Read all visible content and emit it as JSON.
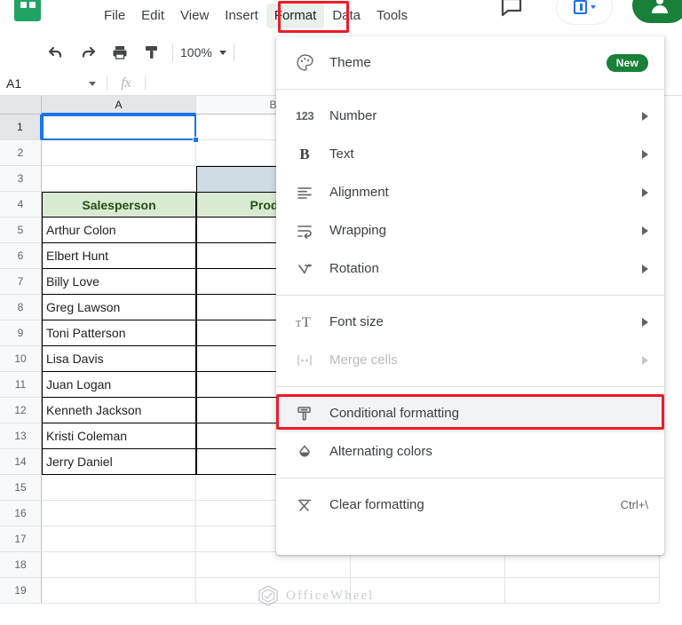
{
  "app": {
    "logo": "sheets-logo",
    "zoom": "100%"
  },
  "menubar": {
    "items": [
      {
        "label": "File",
        "active": false
      },
      {
        "label": "Edit",
        "active": false
      },
      {
        "label": "View",
        "active": false
      },
      {
        "label": "Insert",
        "active": false
      },
      {
        "label": "Format",
        "active": true
      },
      {
        "label": "Data",
        "active": false
      },
      {
        "label": "Tools",
        "active": false
      }
    ]
  },
  "toolbar": {
    "undo": "undo-icon",
    "redo": "redo-icon",
    "print": "print-icon",
    "paint": "paint-format-icon",
    "zoom_value": "100%"
  },
  "formula_bar": {
    "name_box": "A1",
    "fx_label": "fx",
    "formula_value": "",
    "placeholder": ""
  },
  "grid": {
    "columns": [
      "A",
      "B"
    ],
    "rows": [
      "1",
      "2",
      "3",
      "4",
      "5",
      "6",
      "7",
      "8",
      "9",
      "10",
      "11",
      "12",
      "13",
      "14",
      "15",
      "16",
      "17",
      "18",
      "19"
    ],
    "selected_cell": "A1",
    "header_row": {
      "a": "Salesperson",
      "b": "Product"
    },
    "salespersons": [
      "Arthur Colon",
      "Elbert Hunt",
      "Billy Love",
      "Greg Lawson",
      "Toni Patterson",
      "Lisa Davis",
      "Juan Logan",
      "Kenneth Jackson",
      "Kristi Coleman",
      "Jerry Daniel"
    ],
    "colors": {
      "header_fill": "#d9ead3",
      "header_text": "#274e13",
      "b3_fill": "#cfdce3",
      "selection": "#1a73e8"
    }
  },
  "format_menu": {
    "sections": [
      {
        "items": [
          {
            "label": "Theme",
            "icon": "palette-icon",
            "badge": "New",
            "arrow": false,
            "shortcut": "",
            "disabled": false,
            "highlighted": false
          }
        ]
      },
      {
        "items": [
          {
            "label": "Number",
            "icon": "number-123-icon",
            "badge": "",
            "arrow": true,
            "shortcut": "",
            "disabled": false,
            "highlighted": false
          },
          {
            "label": "Text",
            "icon": "bold-b-icon",
            "badge": "",
            "arrow": true,
            "shortcut": "",
            "disabled": false,
            "highlighted": false
          },
          {
            "label": "Alignment",
            "icon": "align-left-icon",
            "badge": "",
            "arrow": true,
            "shortcut": "",
            "disabled": false,
            "highlighted": false
          },
          {
            "label": "Wrapping",
            "icon": "wrap-text-icon",
            "badge": "",
            "arrow": true,
            "shortcut": "",
            "disabled": false,
            "highlighted": false
          },
          {
            "label": "Rotation",
            "icon": "rotation-icon",
            "badge": "",
            "arrow": true,
            "shortcut": "",
            "disabled": false,
            "highlighted": false
          }
        ]
      },
      {
        "items": [
          {
            "label": "Font size",
            "icon": "font-size-icon",
            "badge": "",
            "arrow": true,
            "shortcut": "",
            "disabled": false,
            "highlighted": false
          },
          {
            "label": "Merge cells",
            "icon": "merge-cells-icon",
            "badge": "",
            "arrow": true,
            "shortcut": "",
            "disabled": true,
            "highlighted": false
          }
        ]
      },
      {
        "items": [
          {
            "label": "Conditional formatting",
            "icon": "paint-roller-icon",
            "badge": "",
            "arrow": false,
            "shortcut": "",
            "disabled": false,
            "highlighted": true
          },
          {
            "label": "Alternating colors",
            "icon": "color-drop-icon",
            "badge": "",
            "arrow": false,
            "shortcut": "",
            "disabled": false,
            "highlighted": false
          }
        ]
      },
      {
        "items": [
          {
            "label": "Clear formatting",
            "icon": "clear-format-icon",
            "badge": "",
            "arrow": false,
            "shortcut": "Ctrl+\\",
            "disabled": false,
            "highlighted": false
          }
        ]
      }
    ]
  },
  "watermark": {
    "text": "OfficeWheel"
  },
  "annotations": {
    "format_box_color": "#ee1c25",
    "conditional_box_color": "#ee1c25"
  }
}
